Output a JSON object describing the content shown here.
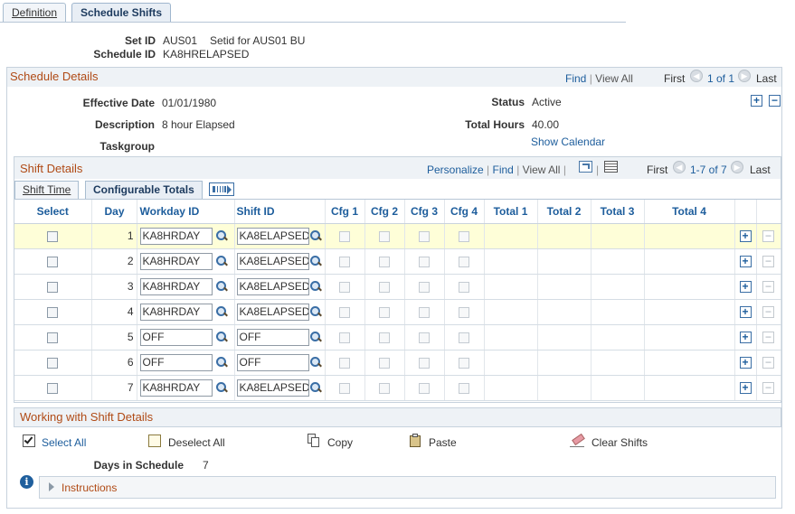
{
  "tabs": [
    {
      "label": "Definition"
    },
    {
      "label": "Schedule Shifts"
    }
  ],
  "header": {
    "setid_label": "Set ID",
    "setid_value": "AUS01",
    "setid_desc": "Setid for AUS01 BU",
    "schedid_label": "Schedule ID",
    "schedid_value": "KA8HRELAPSED"
  },
  "schedule_details": {
    "title": "Schedule Details",
    "find": "Find",
    "view_all": "View All",
    "first": "First",
    "range": "1 of 1",
    "last": "Last",
    "effdate_label": "Effective Date",
    "effdate_value": "01/01/1980",
    "desc_label": "Description",
    "desc_value": "8 hour Elapsed",
    "taskgroup_label": "Taskgroup",
    "status_label": "Status",
    "status_value": "Active",
    "total_hours_label": "Total Hours",
    "total_hours_value": "40.00",
    "show_calendar": "Show Calendar"
  },
  "shift_details": {
    "title": "Shift Details",
    "personalize": "Personalize",
    "find": "Find",
    "view_all": "View All",
    "first": "First",
    "range": "1-7 of 7",
    "last": "Last",
    "tabs": [
      {
        "label": "Shift Time"
      },
      {
        "label": "Configurable Totals"
      }
    ],
    "columns": [
      "Select",
      "Day",
      "Workday ID",
      "Shift ID",
      "Cfg 1",
      "Cfg 2",
      "Cfg 3",
      "Cfg 4",
      "Total 1",
      "Total 2",
      "Total 3",
      "Total 4"
    ],
    "rows": [
      {
        "day": "1",
        "workday": "KA8HRDAY",
        "shift": "KA8ELAPSED"
      },
      {
        "day": "2",
        "workday": "KA8HRDAY",
        "shift": "KA8ELAPSED"
      },
      {
        "day": "3",
        "workday": "KA8HRDAY",
        "shift": "KA8ELAPSED"
      },
      {
        "day": "4",
        "workday": "KA8HRDAY",
        "shift": "KA8ELAPSED"
      },
      {
        "day": "5",
        "workday": "OFF",
        "shift": "OFF"
      },
      {
        "day": "6",
        "workday": "OFF",
        "shift": "OFF"
      },
      {
        "day": "7",
        "workday": "KA8HRDAY",
        "shift": "KA8ELAPSED"
      }
    ]
  },
  "working": {
    "title": "Working with Shift Details",
    "select_all": "Select All",
    "deselect_all": "Deselect All",
    "copy": "Copy",
    "paste": "Paste",
    "clear_shifts": "Clear Shifts",
    "days_label": "Days in Schedule",
    "days_value": "7",
    "instructions": "Instructions"
  },
  "colors": {
    "accent": "#1d5d9c",
    "section_title": "#b04a15",
    "highlight_row": "#fefed8"
  }
}
